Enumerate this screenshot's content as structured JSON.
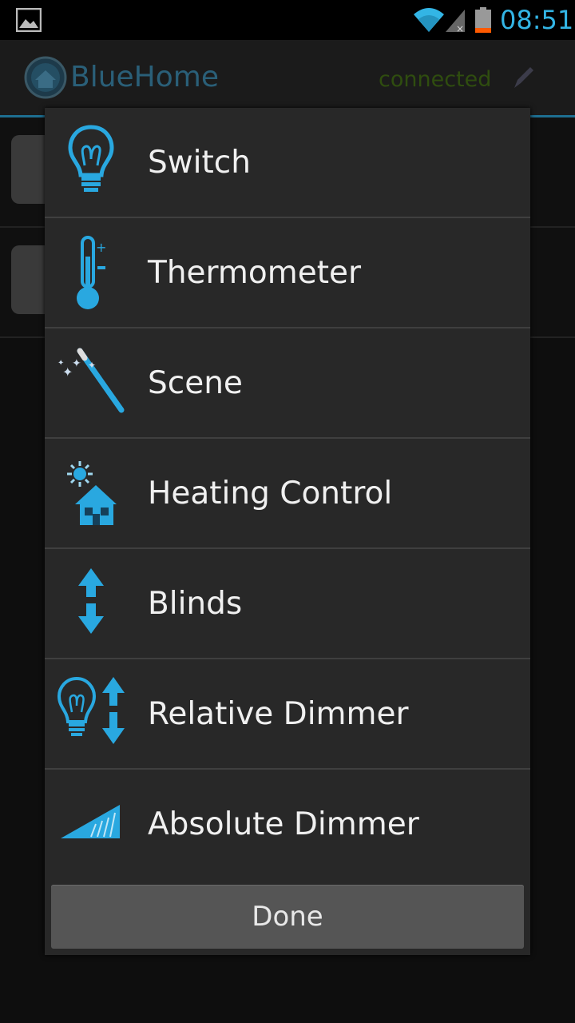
{
  "status_bar": {
    "time": "08:51",
    "icons": [
      "gallery-icon",
      "wifi-icon",
      "signal-icon",
      "battery-icon"
    ],
    "accent_color": "#33b5e5",
    "battery_low_color": "#ff5a00"
  },
  "action_bar": {
    "title": "BlueHome",
    "status": "connected",
    "icons": [
      "app-logo",
      "edit-pen-icon"
    ]
  },
  "dialog": {
    "items": [
      {
        "label": "Switch",
        "icon": "light-bulb-icon"
      },
      {
        "label": "Thermometer",
        "icon": "thermometer-icon"
      },
      {
        "label": "Scene",
        "icon": "magic-wand-icon"
      },
      {
        "label": "Heating Control",
        "icon": "sun-house-icon"
      },
      {
        "label": "Blinds",
        "icon": "up-down-arrows-icon"
      },
      {
        "label": "Relative Dimmer",
        "icon": "bulb-arrows-icon"
      },
      {
        "label": "Absolute Dimmer",
        "icon": "dimmer-ramp-icon"
      }
    ],
    "done_label": "Done"
  },
  "colors": {
    "icon_blue": "#29a8e0",
    "dialog_bg": "#282828",
    "button_bg": "#555555"
  }
}
